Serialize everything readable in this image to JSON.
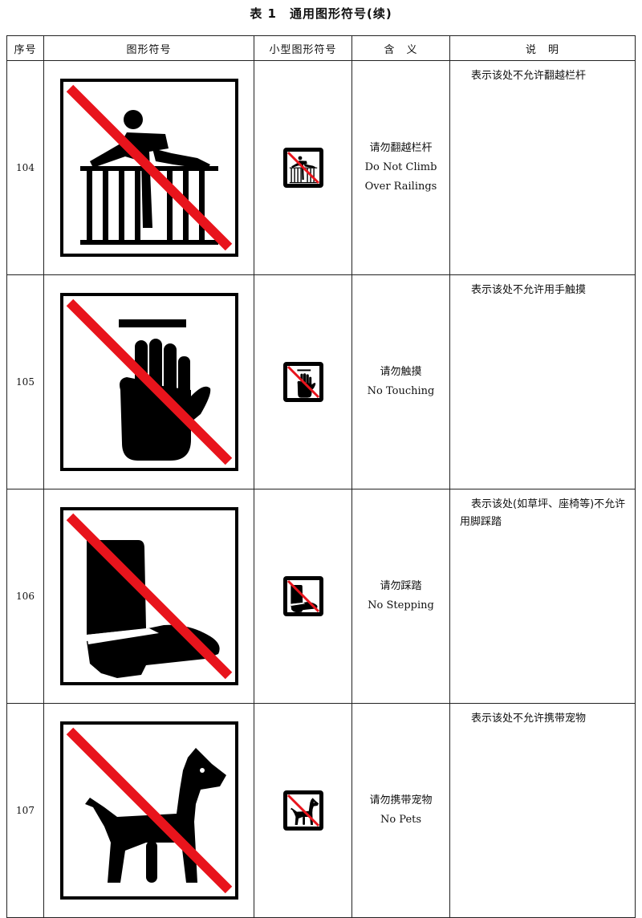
{
  "title": "表 1　通用图形符号(续)",
  "headers": {
    "num": "序号",
    "symbol": "图形符号",
    "small_symbol": "小型图形符号",
    "meaning": "含　义",
    "description": "说　明"
  },
  "rows": [
    {
      "num": "104",
      "meaning_zh": "请勿翻越栏杆",
      "meaning_en_1": "Do Not Climb",
      "meaning_en_2": "Over Railings",
      "description": "表示该处不允许翻越栏杆",
      "icon": "no-climbing-railings-icon"
    },
    {
      "num": "105",
      "meaning_zh": "请勿触摸",
      "meaning_en_1": "No Touching",
      "meaning_en_2": "",
      "description": "表示该处不允许用手触摸",
      "icon": "no-touching-icon"
    },
    {
      "num": "106",
      "meaning_zh": "请勿踩踏",
      "meaning_en_1": "No Stepping",
      "meaning_en_2": "",
      "description": "表示该处(如草坪、座椅等)不允许用脚踩踏",
      "icon": "no-stepping-icon"
    },
    {
      "num": "107",
      "meaning_zh": "请勿携带宠物",
      "meaning_en_1": "No Pets",
      "meaning_en_2": "",
      "description": "表示该处不允许携带宠物",
      "icon": "no-pets-icon"
    }
  ],
  "colors": {
    "prohibition_slash": "#e8141c",
    "symbol_black": "#000000"
  }
}
